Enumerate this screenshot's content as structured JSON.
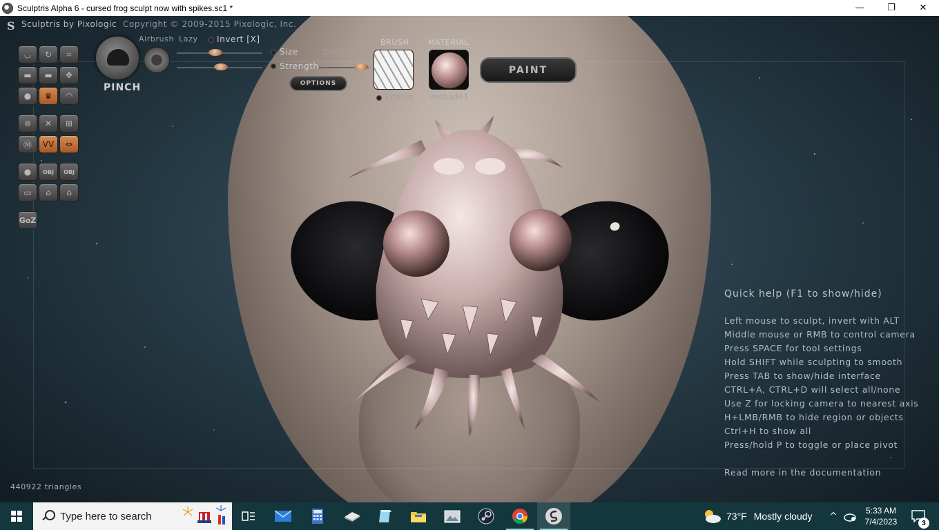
{
  "window": {
    "title": "Sculptris Alpha 6 - cursed frog sculpt now with spikes.sc1 *",
    "minimize": "—",
    "maximize": "❐",
    "close": "✕"
  },
  "header": {
    "brand": "Sculptris by Pixologic",
    "copyright": "Copyright © 2009-2015 Pixologic, Inc.",
    "logo": "S"
  },
  "tools": {
    "goz_label": "GoZ",
    "obj_label": "OBJ",
    "active_tool": "pinch"
  },
  "brush": {
    "name": "PINCH",
    "airbrush_label": "Airbrush",
    "lazy_label": "Lazy",
    "invert_label": "Invert [X]",
    "size_label": "Size",
    "strength_label": "Strength",
    "detail_label": "Detail [Q]",
    "options_label": "OPTIONS",
    "brush_header": "BRUSH",
    "enable_label": "Enable",
    "material_header": "MATERIAL",
    "material_name": "mshade1",
    "paint_label": "PAINT",
    "size_value": 0.45,
    "strength_value": 0.52,
    "detail_value": 0.85
  },
  "quick_help": {
    "title": "Quick help (F1 to show/hide)",
    "lines": [
      "Left mouse to sculpt, invert with ALT",
      "Middle mouse or RMB to control camera",
      "Press SPACE for tool settings",
      "Hold SHIFT while sculpting to smooth",
      "Press TAB to show/hide interface",
      "CTRL+A, CTRL+D will select all/none",
      "Use Z for locking camera to nearest axis",
      "H+LMB/RMB to hide region or objects",
      "Ctrl+H to show all",
      "Press/hold P to toggle or place pivot"
    ],
    "read_more": "Read more in the documentation"
  },
  "status": {
    "triangles": "440922 triangles"
  },
  "taskbar": {
    "search_placeholder": "Type here to search",
    "weather_temp": "73°F",
    "weather_text": "Mostly cloudy",
    "time": "5:33 AM",
    "date": "7/4/2023",
    "notifications": "3",
    "colors": {
      "bar": "#14373d",
      "accent": "#8fd3e8"
    }
  }
}
